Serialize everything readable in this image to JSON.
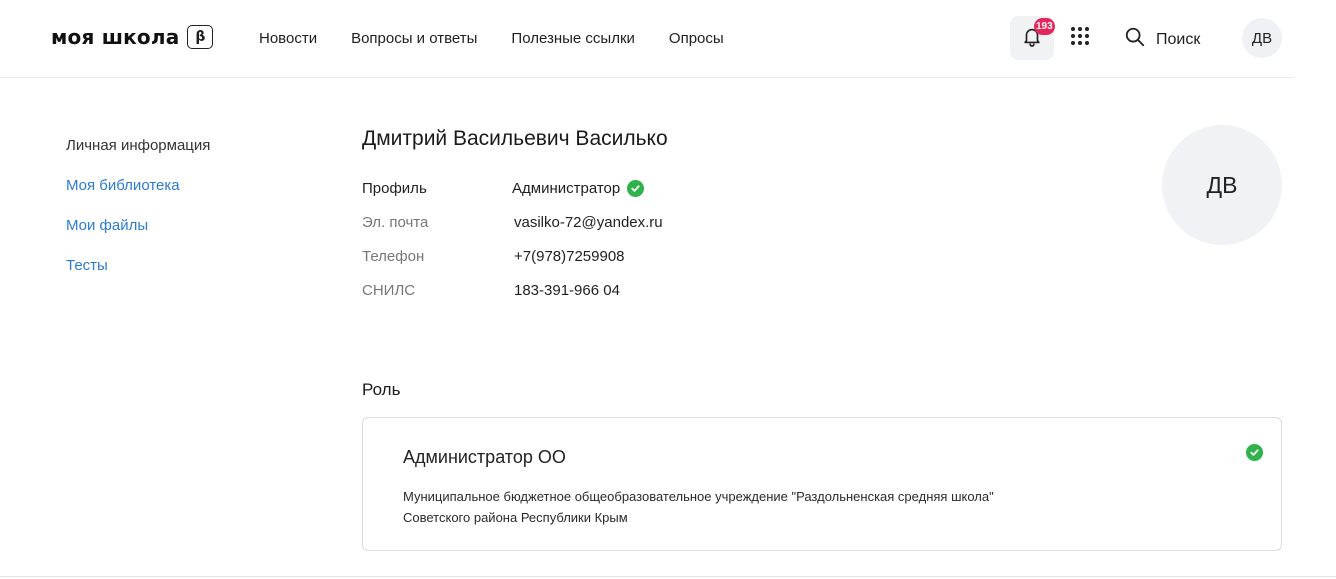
{
  "header": {
    "logo": "моя школа",
    "beta": "β",
    "nav": [
      "Новости",
      "Вопросы и ответы",
      "Полезные ссылки",
      "Опросы"
    ],
    "notifications_count": "193",
    "search_label": "Поиск",
    "avatar_initials": "ДВ"
  },
  "sidebar": {
    "items": [
      "Личная информация",
      "Моя библиотека",
      "Мои файлы",
      "Тесты"
    ]
  },
  "profile": {
    "full_name": "Дмитрий Васильевич Василько",
    "rows": [
      {
        "label": "Профиль",
        "value": "Администратор"
      },
      {
        "label": "Эл. почта",
        "value": "vasilko-72@yandex.ru"
      },
      {
        "label": "Телефон",
        "value": "+7(978)7259908"
      },
      {
        "label": "СНИЛС",
        "value": "183-391-966 04"
      }
    ],
    "avatar_initials": "ДВ"
  },
  "role": {
    "section_title": "Роль",
    "name": "Администратор ОО",
    "organization": "Муниципальное бюджетное общеобразовательное учреждение \"Раздольненская средняя школа\" Советского района Республики Крым"
  },
  "colors": {
    "accent_link": "#2c7bce",
    "success": "#2fb34a",
    "badge": "#e4265a"
  }
}
